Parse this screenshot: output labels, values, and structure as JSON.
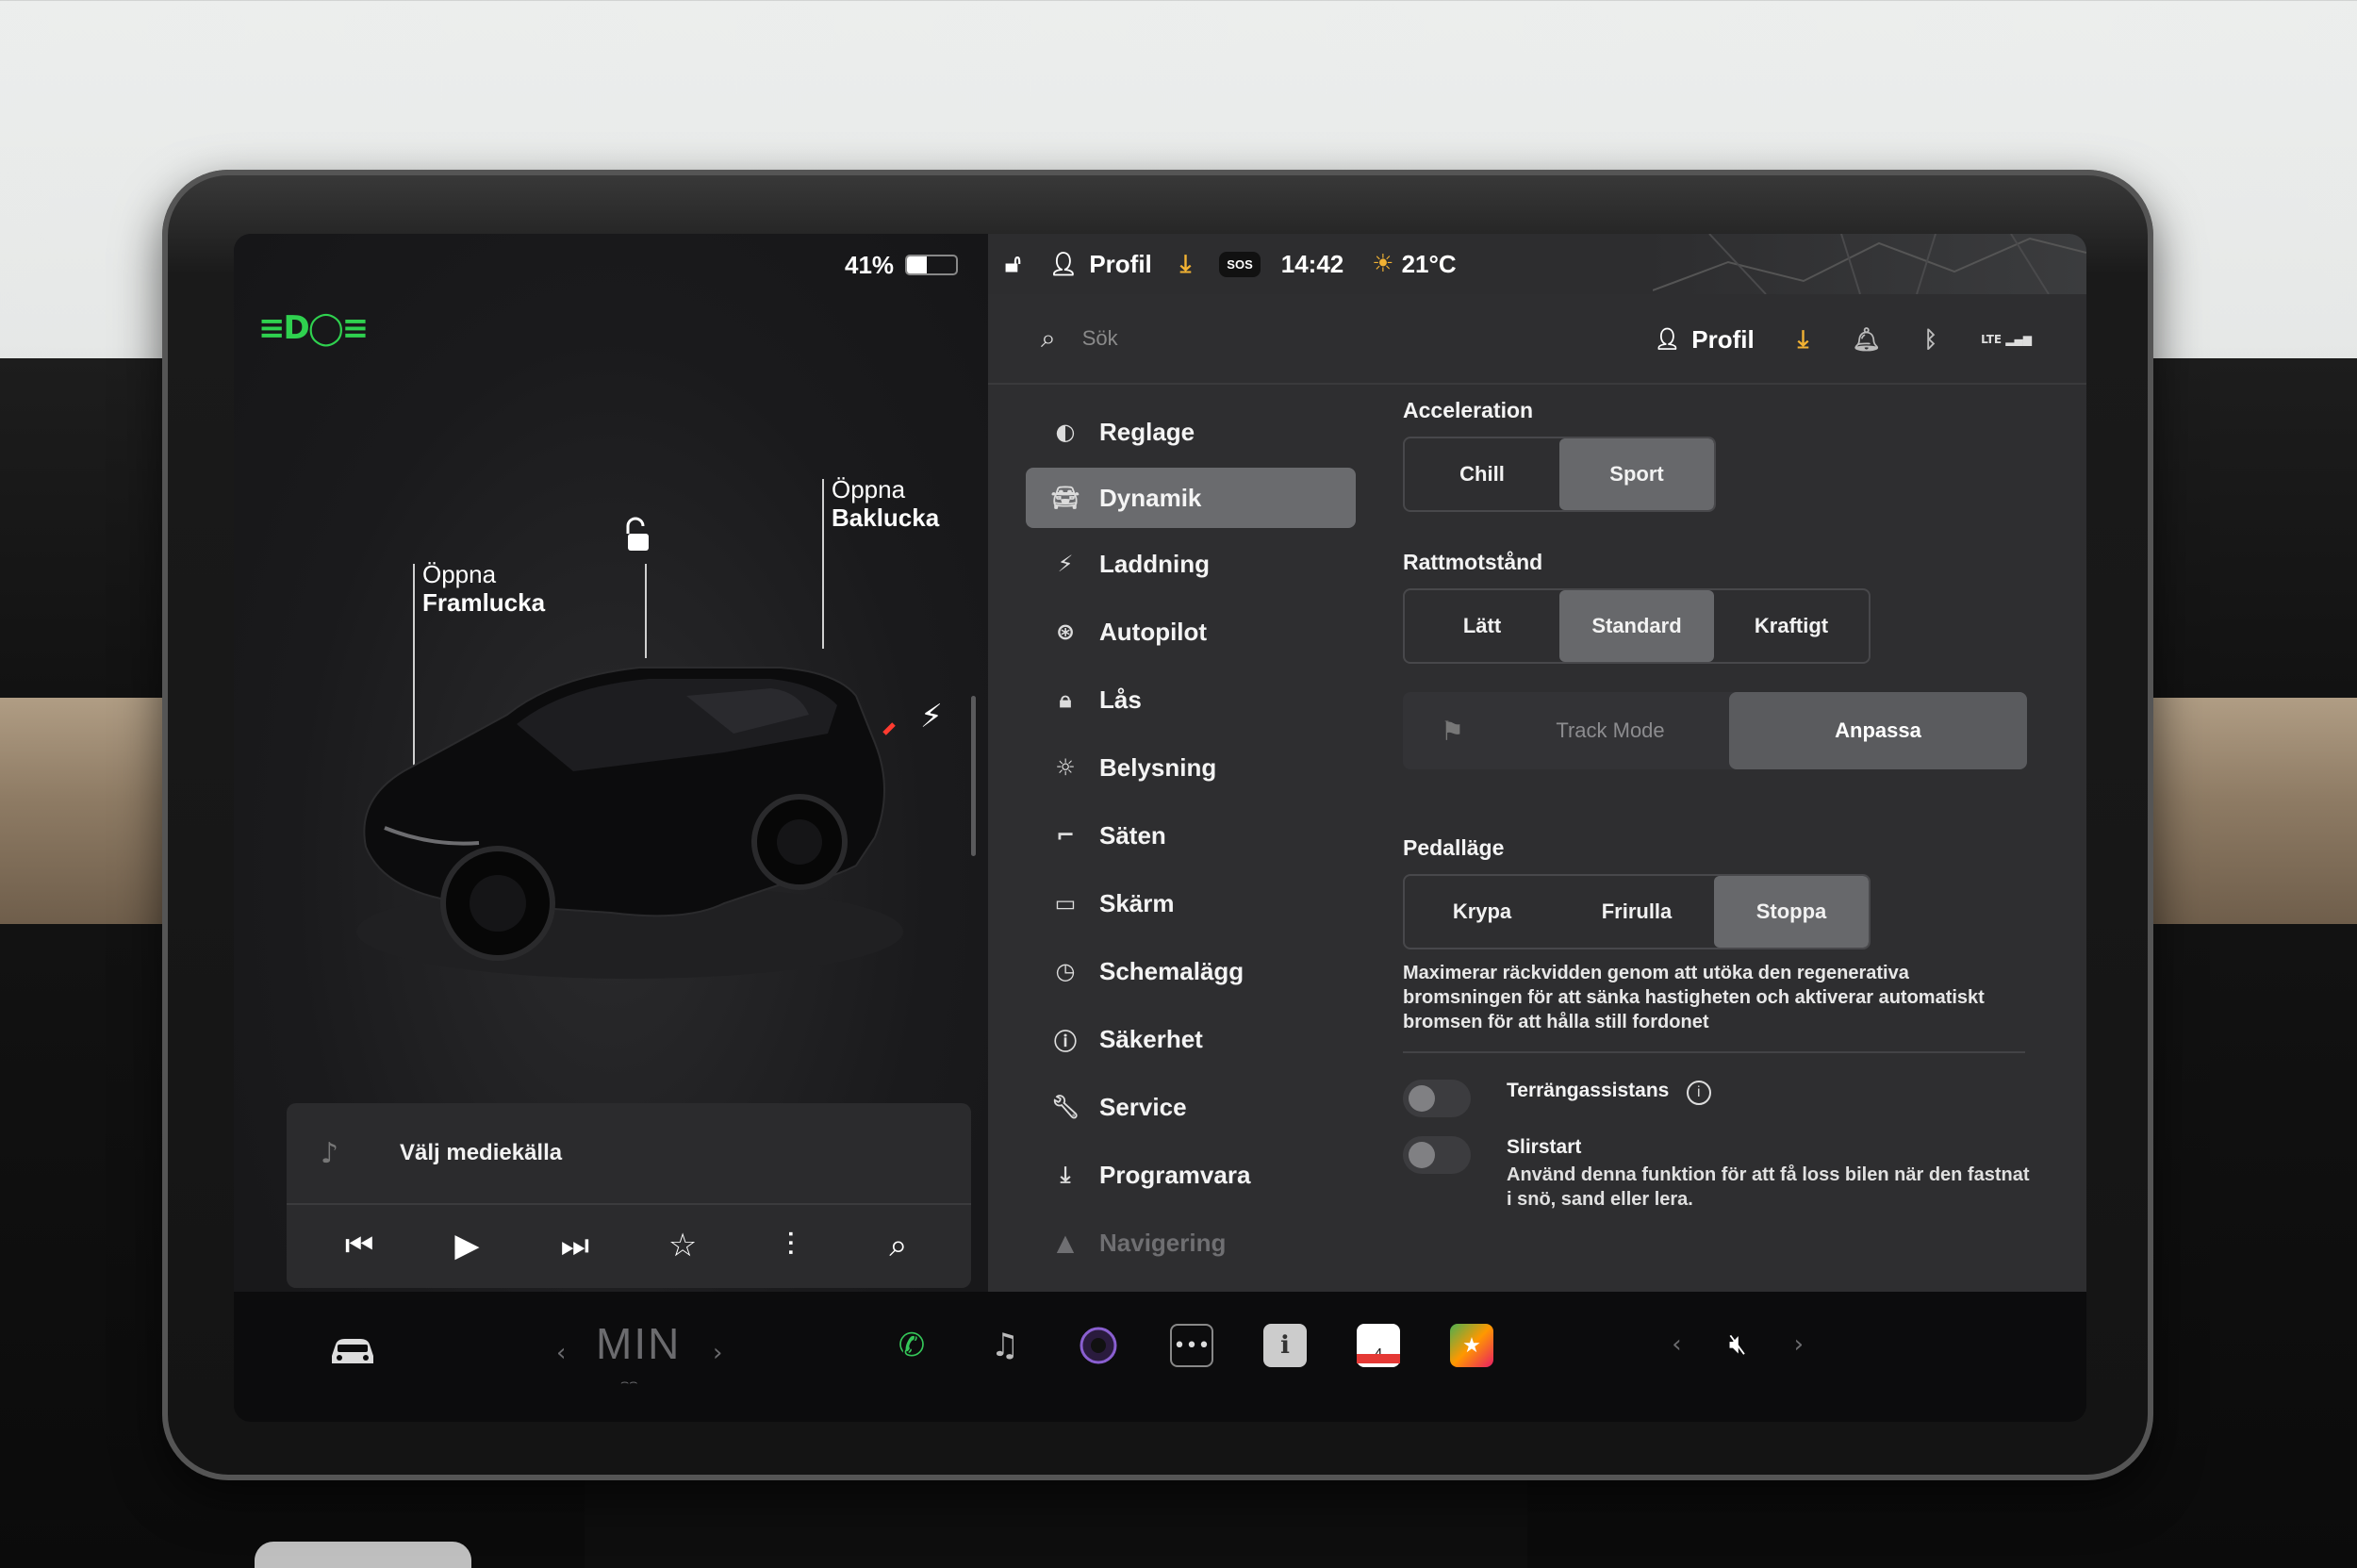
{
  "left_panel": {
    "battery_percent": "41%",
    "battery_level": 0.41,
    "frunk": {
      "line1": "Öppna",
      "line2": "Framlucka"
    },
    "trunk": {
      "line1": "Öppna",
      "line2": "Baklucka"
    }
  },
  "media": {
    "source_label": "Välj mediekälla",
    "controls": [
      "previous-icon",
      "play-icon",
      "next-icon",
      "star-icon",
      "equalizer-icon",
      "search-icon"
    ]
  },
  "status_bar": {
    "profile_label": "Profil",
    "sos_label": "SOS",
    "time": "14:42",
    "temperature": "21°C"
  },
  "settings": {
    "search_placeholder": "Sök",
    "profile_label": "Profil",
    "lte_label": "LTE",
    "nav": [
      {
        "label": "Reglage",
        "icon": "toggle-icon"
      },
      {
        "label": "Dynamik",
        "icon": "car-icon",
        "active": true
      },
      {
        "label": "Laddning",
        "icon": "bolt-icon"
      },
      {
        "label": "Autopilot",
        "icon": "steering-wheel-icon"
      },
      {
        "label": "Lås",
        "icon": "lock-icon"
      },
      {
        "label": "Belysning",
        "icon": "sun-icon"
      },
      {
        "label": "Säten",
        "icon": "seat-icon"
      },
      {
        "label": "Skärm",
        "icon": "screen-icon"
      },
      {
        "label": "Schemalägg",
        "icon": "clock-icon"
      },
      {
        "label": "Säkerhet",
        "icon": "alert-icon"
      },
      {
        "label": "Service",
        "icon": "wrench-icon"
      },
      {
        "label": "Programvara",
        "icon": "download-icon"
      },
      {
        "label": "Navigering",
        "icon": "navigation-icon"
      }
    ],
    "acceleration": {
      "label": "Acceleration",
      "options": [
        "Chill",
        "Sport"
      ],
      "selected": "Sport"
    },
    "steering": {
      "label": "Rattmotstånd",
      "options": [
        "Lätt",
        "Standard",
        "Kraftigt"
      ],
      "selected": "Standard"
    },
    "track_mode": {
      "label": "Track Mode",
      "customize_label": "Anpassa"
    },
    "pedal": {
      "label": "Pedalläge",
      "options": [
        "Krypa",
        "Frirulla",
        "Stoppa"
      ],
      "selected": "Stoppa",
      "description": "Maximerar räckvidden genom att utöka den regenerativa bromsningen för att sänka hastigheten och aktiverar automatiskt bromsen för att hålla still fordonet"
    },
    "terrain_assist": {
      "label": "Terrängassistans",
      "enabled": false
    },
    "slip_start": {
      "label": "Slirstart",
      "description": "Använd denna funktion för att få loss bilen när den fastnat i snö, sand eller lera.",
      "enabled": false
    }
  },
  "dock": {
    "temperature_label": "MIN",
    "calendar_day": "4",
    "apps": [
      "phone-icon",
      "music-icon",
      "camera-icon",
      "more-icon",
      "manual-icon",
      "calendar-icon",
      "games-icon"
    ]
  },
  "colors": {
    "headlight_green": "#2fd14f",
    "download_orange": "#f2b233",
    "phone_green": "#35c759",
    "selected_segment": "#67686b"
  }
}
